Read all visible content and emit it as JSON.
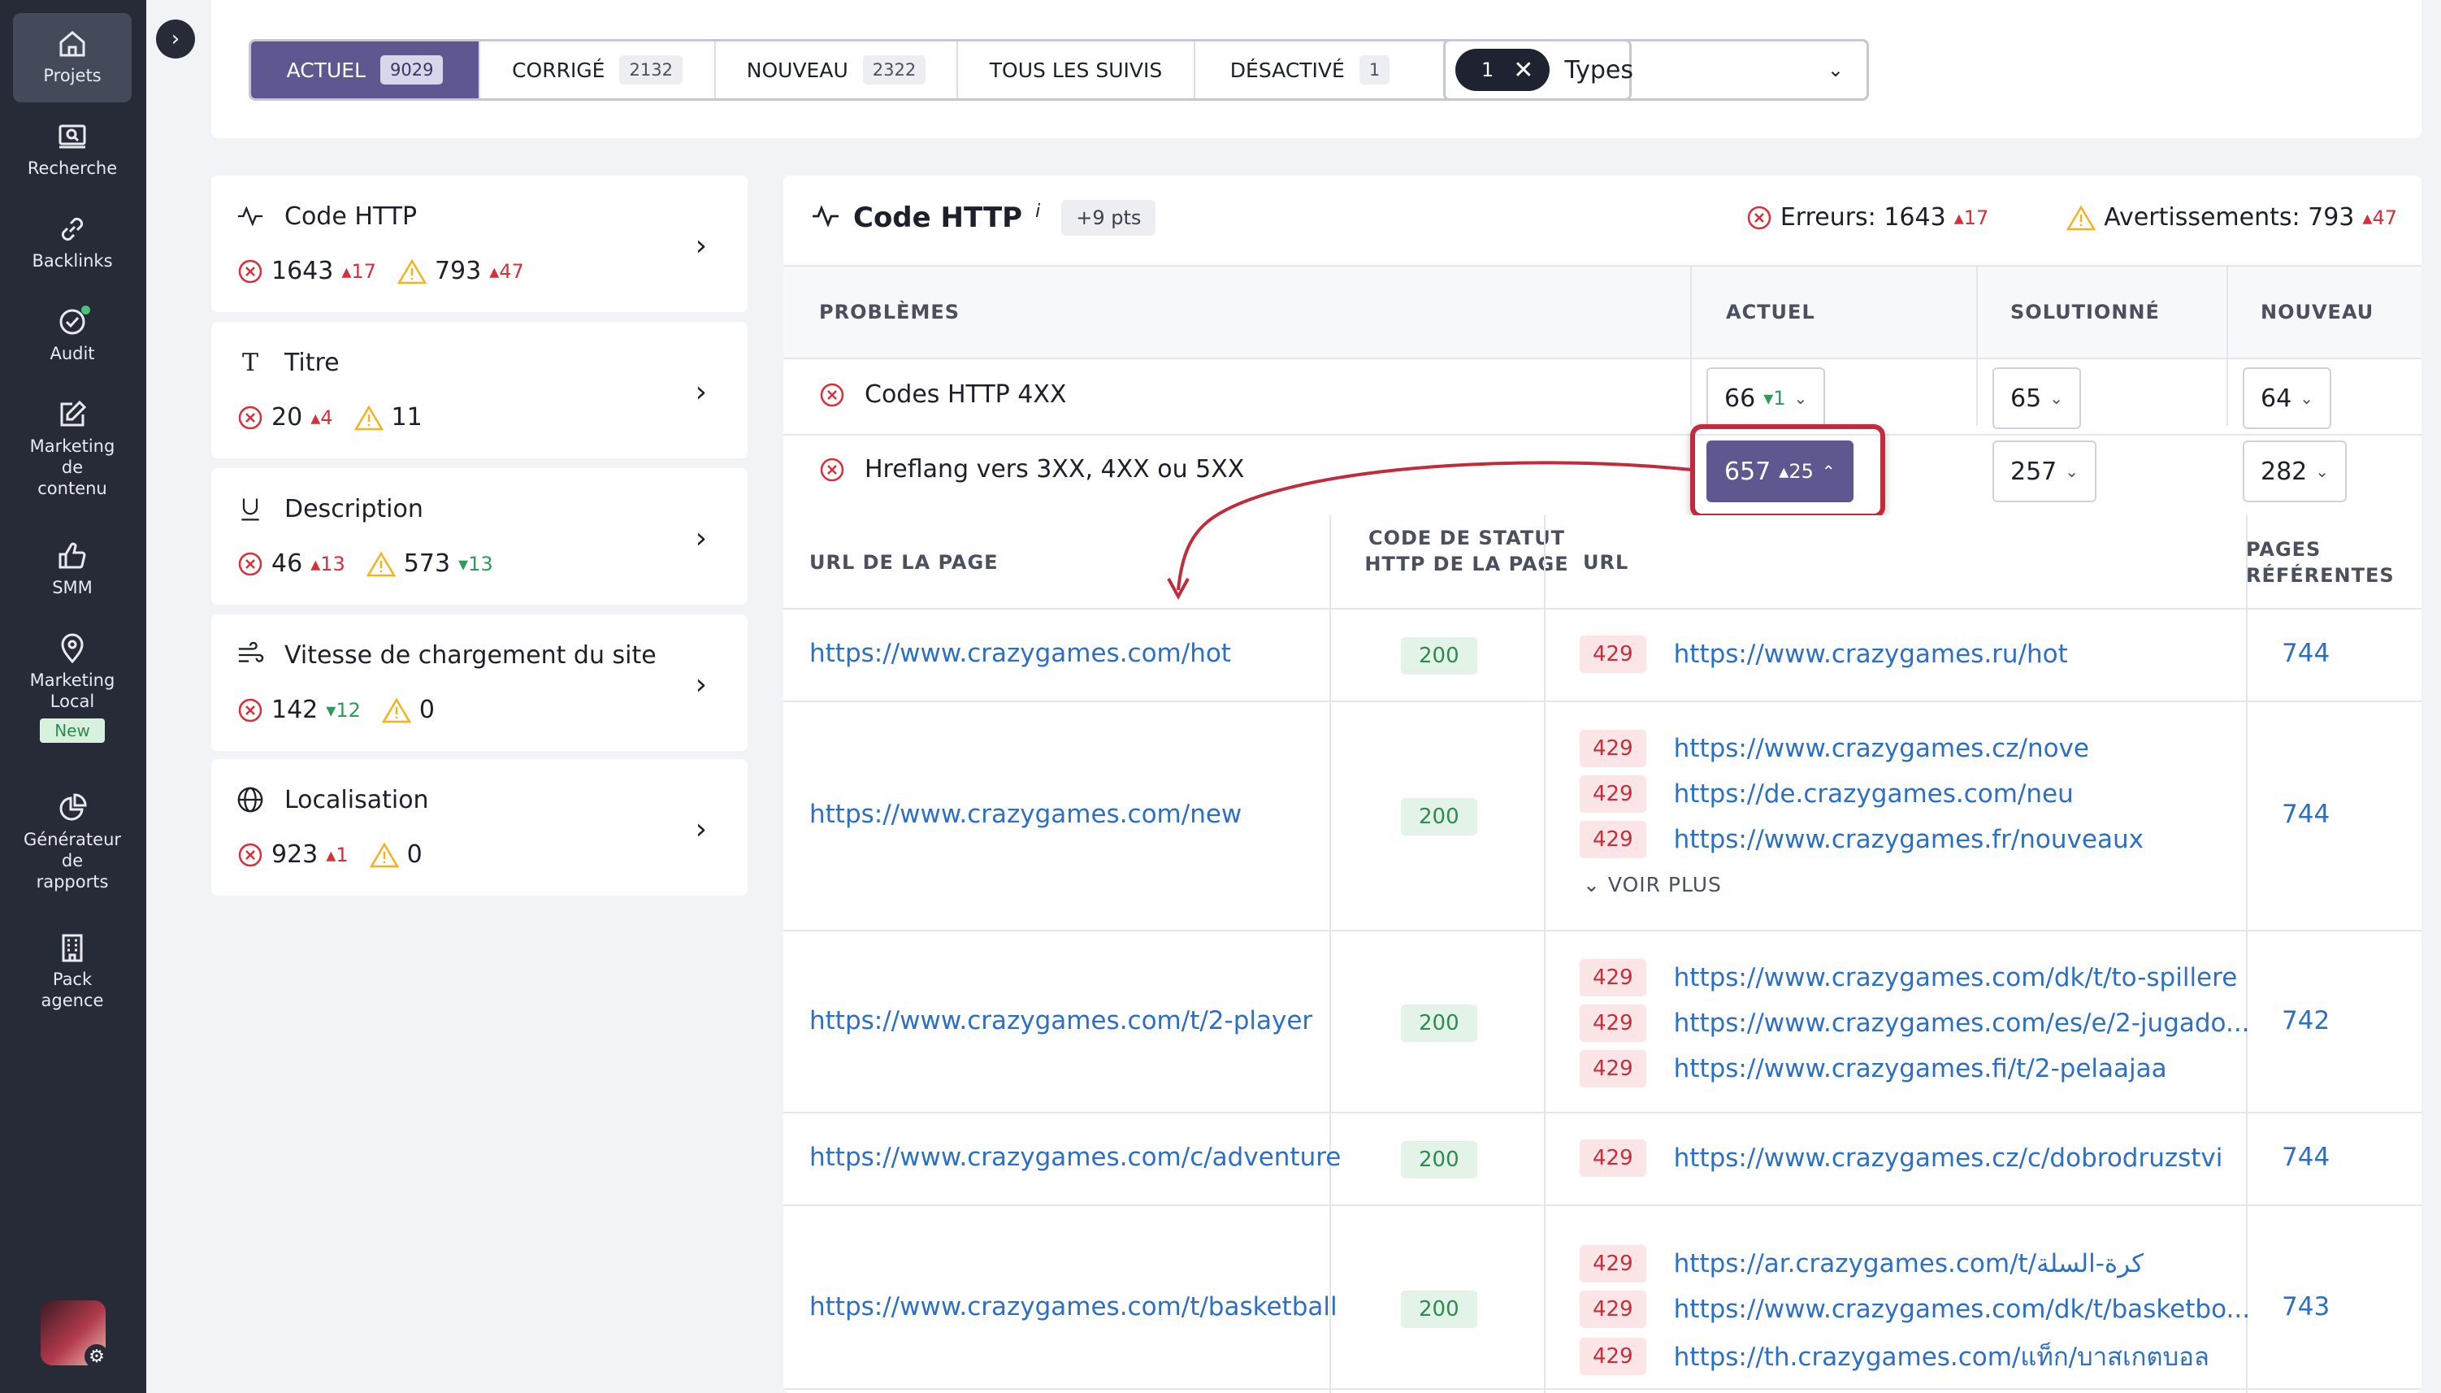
{
  "sidebar": {
    "items": [
      {
        "label": "Projets",
        "icon": "home-icon"
      },
      {
        "label": "Recherche",
        "icon": "search-screen-icon"
      },
      {
        "label": "Backlinks",
        "icon": "link-icon"
      },
      {
        "label": "Audit",
        "icon": "check-circle-icon"
      },
      {
        "label": "Marketing de contenu",
        "icon": "edit-icon"
      },
      {
        "label": "SMM",
        "icon": "thumbs-up-icon"
      },
      {
        "label": "Marketing Local",
        "icon": "location-pin-icon",
        "badge": "New"
      },
      {
        "label": "Générateur de rapports",
        "icon": "pie-chart-icon"
      },
      {
        "label": "Pack agence",
        "icon": "building-icon"
      }
    ]
  },
  "filters": {
    "tabs": [
      {
        "label": "ACTUEL",
        "count": "9029"
      },
      {
        "label": "CORRIGÉ",
        "count": "2132"
      },
      {
        "label": "NOUVEAU",
        "count": "2322"
      },
      {
        "label": "TOUS LES SUIVIS",
        "count": ""
      },
      {
        "label": "DÉSACTIVÉ",
        "count": "1"
      }
    ],
    "types_count": "1",
    "types_label": "Types"
  },
  "categories": [
    {
      "title": "Code HTTP",
      "errors": "1643",
      "errors_delta": "17",
      "errors_dir": "up",
      "warnings": "793",
      "warnings_delta": "47",
      "warnings_dir": "up"
    },
    {
      "title": "Titre",
      "errors": "20",
      "errors_delta": "4",
      "errors_dir": "up",
      "warnings": "11",
      "warnings_delta": "",
      "warnings_dir": ""
    },
    {
      "title": "Description",
      "errors": "46",
      "errors_delta": "13",
      "errors_dir": "up",
      "warnings": "573",
      "warnings_delta": "13",
      "warnings_dir": "down"
    },
    {
      "title": "Vitesse de chargement du site",
      "errors": "142",
      "errors_delta": "12",
      "errors_dir": "down",
      "warnings": "0",
      "warnings_delta": "",
      "warnings_dir": ""
    },
    {
      "title": "Localisation",
      "errors": "923",
      "errors_delta": "1",
      "errors_dir": "up",
      "warnings": "0",
      "warnings_delta": "",
      "warnings_dir": ""
    }
  ],
  "panel": {
    "title": "Code HTTP",
    "info": "i",
    "points": "+9 pts",
    "errors_label": "Erreurs: 1643",
    "errors_delta": "17",
    "warnings_label": "Avertissements: 793",
    "warnings_delta": "47",
    "columns": {
      "problems": "PROBLÈMES",
      "current": "ACTUEL",
      "solved": "SOLUTIONNÉ",
      "new": "NOUVEAU"
    },
    "problems": [
      {
        "label": "Codes HTTP 4XX",
        "current": "66",
        "current_delta": "1",
        "current_dir": "down",
        "solved": "65",
        "new": "64"
      },
      {
        "label": "Hreflang vers 3XX, 4XX ou 5XX",
        "current": "657",
        "current_delta": "25",
        "current_dir": "up",
        "solved": "257",
        "new": "282"
      }
    ],
    "sub_columns": {
      "page_url": "URL DE LA PAGE",
      "status_code": "CODE DE STATUT HTTP DE LA PAGE",
      "url": "URL",
      "ref_pages": "PAGES RÉFÉRENTES"
    },
    "rows": [
      {
        "page": "https://www.crazygames.com/hot",
        "status": "200",
        "urls": [
          {
            "code": "429",
            "url": "https://www.crazygames.ru/hot"
          }
        ],
        "more": "",
        "refs": "744"
      },
      {
        "page": "https://www.crazygames.com/new",
        "status": "200",
        "urls": [
          {
            "code": "429",
            "url": "https://www.crazygames.cz/nove"
          },
          {
            "code": "429",
            "url": "https://de.crazygames.com/neu"
          },
          {
            "code": "429",
            "url": "https://www.crazygames.fr/nouveaux"
          }
        ],
        "more": "VOIR PLUS",
        "refs": "744"
      },
      {
        "page": "https://www.crazygames.com/t/2-player",
        "status": "200",
        "urls": [
          {
            "code": "429",
            "url": "https://www.crazygames.com/dk/t/to-spillere"
          },
          {
            "code": "429",
            "url": "https://www.crazygames.com/es/e/2-jugado..."
          },
          {
            "code": "429",
            "url": "https://www.crazygames.fi/t/2-pelaajaa"
          }
        ],
        "more": "",
        "refs": "742"
      },
      {
        "page": "https://www.crazygames.com/c/adventure",
        "status": "200",
        "urls": [
          {
            "code": "429",
            "url": "https://www.crazygames.cz/c/dobrodruzstvi"
          }
        ],
        "more": "",
        "refs": "744"
      },
      {
        "page": "https://www.crazygames.com/t/basketball",
        "status": "200",
        "urls": [
          {
            "code": "429",
            "url": "https://ar.crazygames.com/t/كرة-السلة"
          },
          {
            "code": "429",
            "url": "https://www.crazygames.com/dk/t/basketbo..."
          },
          {
            "code": "429",
            "url": "https://th.crazygames.com/แท็ก/บาสเกตบอล"
          }
        ],
        "more": "",
        "refs": "743"
      }
    ]
  },
  "colors": {
    "sidebar_bg": "#272b38",
    "accent_purple": "#5e5790",
    "error_red": "#d8303b",
    "warning_yellow": "#f2b31f",
    "link_blue": "#2d6fc4",
    "ok_green": "#2f8a50",
    "highlight_ring": "#c12b3c"
  }
}
